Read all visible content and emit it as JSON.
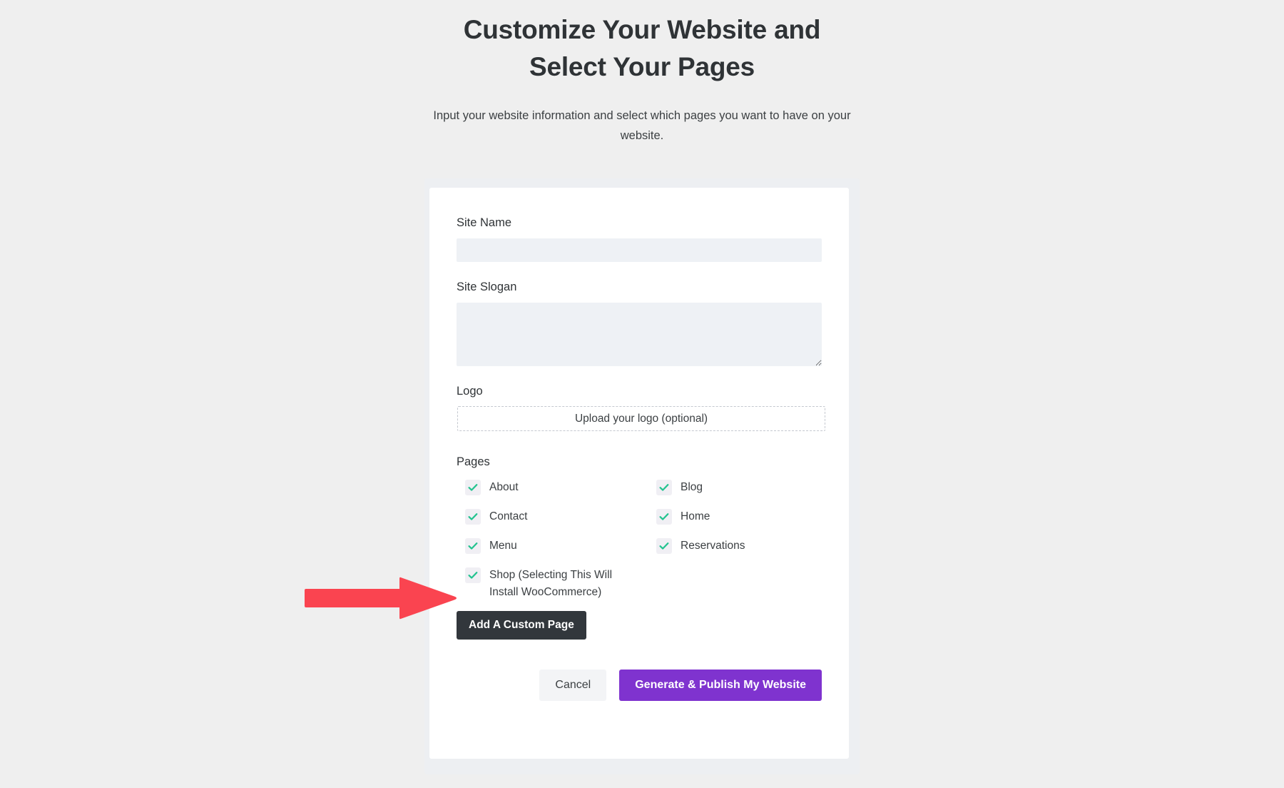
{
  "header": {
    "title": "Customize Your Website and Select Your Pages",
    "subtitle": "Input your website information and select which pages you want to have on your website."
  },
  "form": {
    "site_name": {
      "label": "Site Name",
      "value": "",
      "placeholder": ""
    },
    "site_slogan": {
      "label": "Site Slogan",
      "value": "",
      "placeholder": ""
    },
    "logo": {
      "label": "Logo",
      "upload_text": "Upload your logo (optional)"
    },
    "pages": {
      "label": "Pages",
      "items": [
        {
          "label": "About",
          "checked": true
        },
        {
          "label": "Blog",
          "checked": true
        },
        {
          "label": "Contact",
          "checked": true
        },
        {
          "label": "Home",
          "checked": true
        },
        {
          "label": "Menu",
          "checked": true
        },
        {
          "label": "Reservations",
          "checked": true
        },
        {
          "label": "Shop (Selecting This Will Install WooCommerce)",
          "checked": true
        }
      ]
    },
    "add_custom_page_label": "Add A Custom Page"
  },
  "actions": {
    "cancel_label": "Cancel",
    "submit_label": "Generate & Publish My Website"
  },
  "annotation": {
    "type": "arrow",
    "direction": "right",
    "points_to": "Shop (Selecting This Will Install WooCommerce)",
    "color": "#fa4450"
  },
  "colors": {
    "page_background": "#efefef",
    "card_background": "#ffffff",
    "input_background": "#eef1f5",
    "checkbox_background": "#f0eff4",
    "check_green": "#22c38f",
    "primary_purple": "#7f33cf",
    "dark_button": "#32373c",
    "cancel_button": "#f3f4f6",
    "annotation_red": "#fa4450",
    "text_primary": "#2f3336",
    "text_secondary": "#3c4043"
  }
}
